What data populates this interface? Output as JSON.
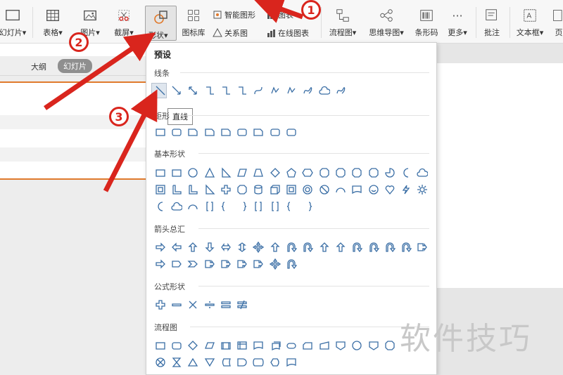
{
  "ribbon": {
    "slide_label": "幻灯片",
    "table_label": "表格",
    "picture_label": "图片",
    "screenshot_label": "截屏",
    "shape_label": "形状",
    "icon_library_label": "图标库",
    "smart_graphic_label": "智能图形",
    "relation_graph_label": "关系图",
    "chart_label": "图表",
    "online_chart_label": "在线图表",
    "flowchart_label": "流程图",
    "mindmap_label": "思维导图",
    "barcode_label": "条形码",
    "more_label": "更多",
    "comment_label": "批注",
    "textbox_label": "文本框",
    "page_label": "页"
  },
  "sidebar": {
    "tab_outline": "大纲",
    "tab_slides": "幻灯片"
  },
  "dropdown": {
    "preset_title": "预设",
    "sections": {
      "lines": "线条",
      "rectangles": "矩形",
      "basic_shapes": "基本形状",
      "block_arrows": "箭头总汇",
      "equation_shapes": "公式形状",
      "flowchart": "流程图"
    },
    "tooltip": "直线"
  },
  "annotations": {
    "step1": "1",
    "step2": "2",
    "step3": "3",
    "arrow_color": "#d9251d"
  },
  "watermark": "软件技巧",
  "colors": {
    "accent_orange": "#e07a2c",
    "shape_blue": "#3a6ea5"
  }
}
